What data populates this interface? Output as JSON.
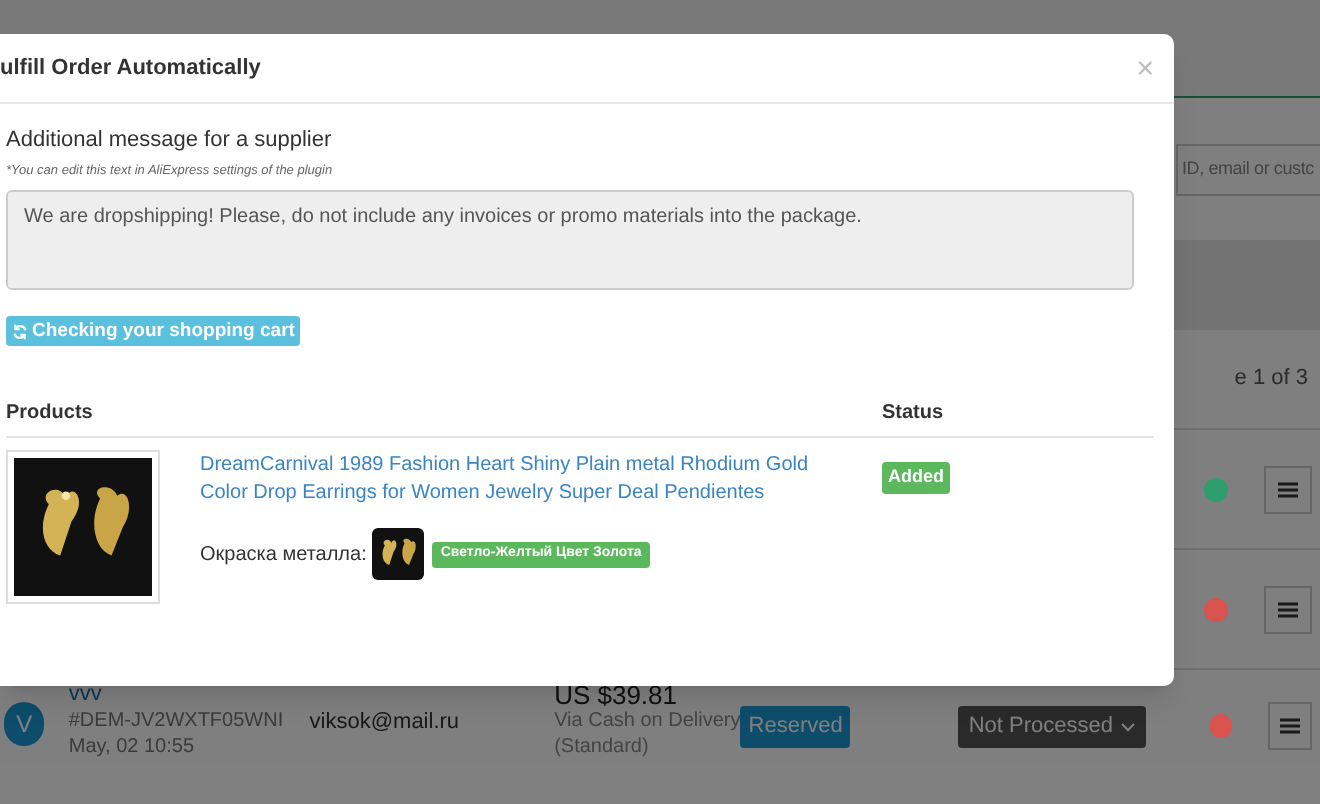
{
  "background_page": {
    "search": {
      "placeholder": "ID, email or custc"
    },
    "pager": "e 1 of 3",
    "rows": [
      {
        "color": "#2e9e6e"
      },
      {
        "color": "#d9534f"
      }
    ],
    "last_order": {
      "avatar": "V",
      "customer": "vvv",
      "order_id": "#DEM-JV2WXTF05WNI",
      "date": "May, 02 10:55",
      "email": "viksok@mail.ru",
      "amount": "US $39.81",
      "payment": "Via Cash on Delivery",
      "shipping": "(Standard)",
      "badge": "Reserved",
      "fulfillment": "Not Processed",
      "color": "#d9534f"
    }
  },
  "modal": {
    "title": "ulfill Order Automatically",
    "close": "×",
    "message_label": "Additional message for a supplier",
    "message_hint": "*You can edit this text in AliExpress settings of the plugin",
    "message": "We are dropshipping! Please, do not include any invoices or promo materials into the package.",
    "check_button": "Checking your shopping cart",
    "table": {
      "columns": [
        "Products",
        "Status"
      ],
      "rows": [
        {
          "product": "DreamCarnival 1989 Fashion Heart Shiny Plain metal Rhodium Gold Color Drop Earrings for Women Jewelry Super Deal Pendientes",
          "option_label": "Окраска металла:",
          "option_value": "Светло-Желтый Цвет Золота",
          "status": "Added"
        }
      ]
    }
  }
}
